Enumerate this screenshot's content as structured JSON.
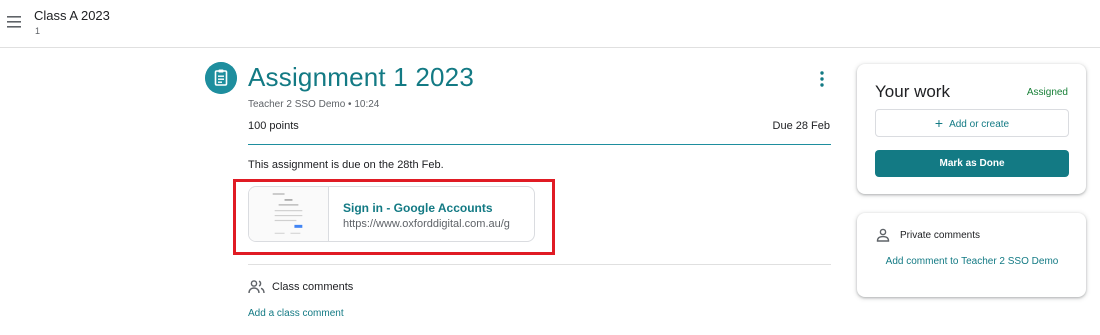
{
  "header": {
    "class_name": "Class A 2023",
    "class_section": "1"
  },
  "assignment": {
    "title": "Assignment 1 2023",
    "meta": "Teacher 2 SSO Demo • 10:24",
    "points": "100 points",
    "due": "Due 28 Feb",
    "instructions": "This assignment is due on the 28th Feb.",
    "attachment": {
      "title": "Sign in - Google Accounts",
      "url": "https://www.oxforddigital.com.au/g"
    }
  },
  "class_comments": {
    "label": "Class comments",
    "add_link": "Add a class comment"
  },
  "your_work": {
    "title": "Your work",
    "status": "Assigned",
    "add_button": "Add or create",
    "done_button": "Mark as Done"
  },
  "private_comments": {
    "label": "Private comments",
    "add_link": "Add comment to Teacher 2 SSO Demo"
  },
  "colors": {
    "accent": "#137a84",
    "status": "#188038",
    "highlight": "#e01b24"
  }
}
